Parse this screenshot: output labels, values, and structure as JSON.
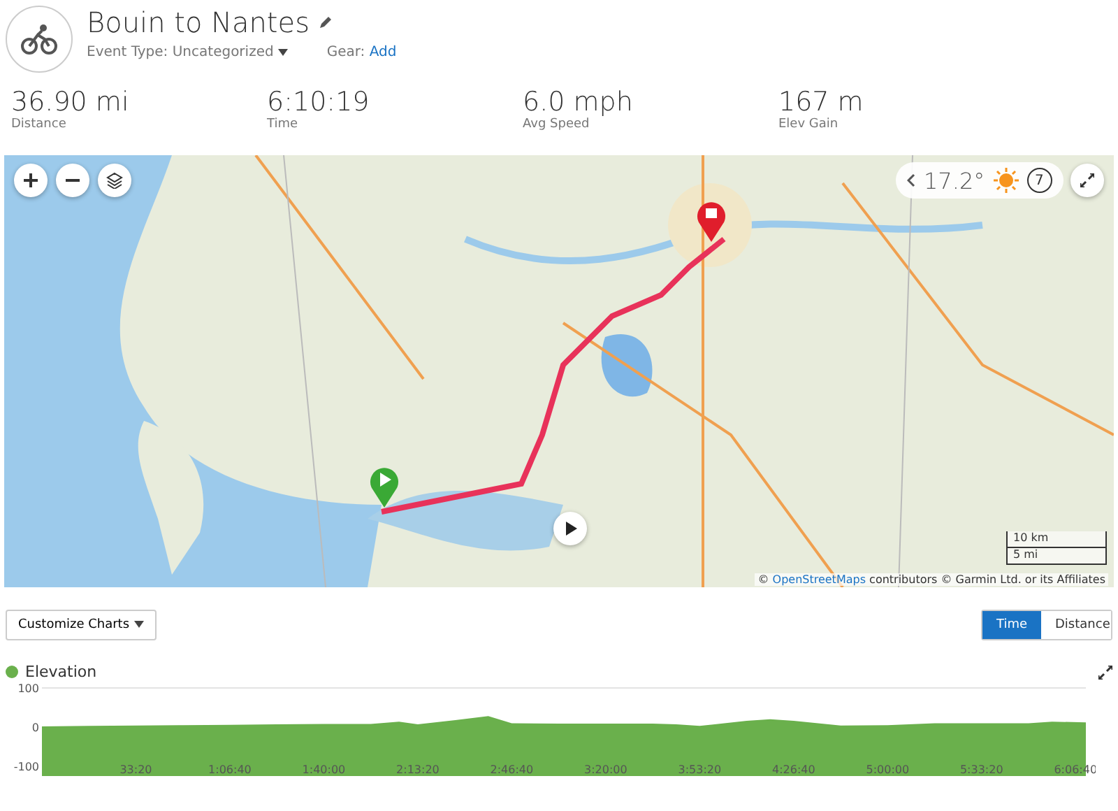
{
  "header": {
    "title": "Bouin to Nantes",
    "event_type_label": "Event Type:",
    "event_type": "Uncategorized",
    "gear_label": "Gear:",
    "gear_link": "Add"
  },
  "stats": [
    {
      "value": "36.90 mi",
      "label": "Distance"
    },
    {
      "value": "6:10:19",
      "label": "Time"
    },
    {
      "value": "6.0 mph",
      "label": "Avg Speed"
    },
    {
      "value": "167 m",
      "label": "Elev Gain"
    }
  ],
  "map": {
    "kind": "picture",
    "weather": {
      "temperature": "17.2°",
      "wind": "7"
    },
    "scale": [
      "10 km",
      "5 mi"
    ],
    "attribution_prefix": "©",
    "attribution_link": "OpenStreetMaps",
    "attribution_rest": "contributors © Garmin Ltd. or its Affiliates"
  },
  "chart_controls": {
    "customize": "Customize Charts",
    "toggle": [
      {
        "label": "Time",
        "selected": true
      },
      {
        "label": "Distance",
        "selected": false
      }
    ]
  },
  "elevation": {
    "chart_data": {
      "type": "area",
      "x": [
        0,
        1000,
        2000,
        3000,
        4000,
        5000,
        6000,
        7000,
        7600,
        8000,
        8800,
        9500,
        10000,
        11000,
        12000,
        13000,
        13500,
        14000,
        15000,
        15500,
        16000,
        17000,
        18000,
        19000,
        20000,
        21000,
        21500,
        22219
      ],
      "series": [
        {
          "name": "Elevation",
          "color": "#6ab04c",
          "values": [
            2,
            3,
            4,
            5,
            6,
            7,
            8,
            8,
            14,
            7,
            18,
            28,
            10,
            9,
            9,
            9,
            7,
            3,
            16,
            20,
            16,
            4,
            5,
            10,
            10,
            10,
            14,
            12
          ]
        }
      ],
      "ylim": [
        -100,
        100
      ],
      "yticks": [
        100,
        0,
        -100
      ],
      "xlim": [
        0,
        22219
      ],
      "xticks": [
        {
          "value": 2000,
          "label": "33:20"
        },
        {
          "value": 4000,
          "label": "1:06:40"
        },
        {
          "value": 6000,
          "label": "1:40:00"
        },
        {
          "value": 8000,
          "label": "2:13:20"
        },
        {
          "value": 10000,
          "label": "2:46:40"
        },
        {
          "value": 12000,
          "label": "3:20:00"
        },
        {
          "value": 14000,
          "label": "3:53:20"
        },
        {
          "value": 16000,
          "label": "4:26:40"
        },
        {
          "value": 18000,
          "label": "5:00:00"
        },
        {
          "value": 20000,
          "label": "5:33:20"
        },
        {
          "value": 22000,
          "label": "6:06:40"
        }
      ]
    }
  }
}
